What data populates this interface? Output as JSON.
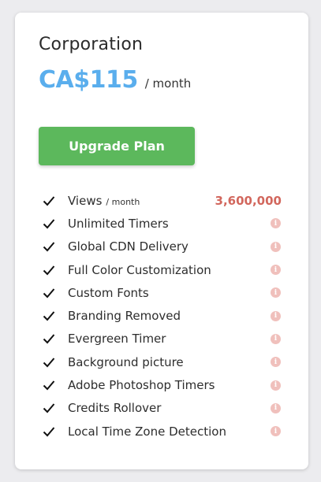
{
  "plan": {
    "name": "Corporation",
    "price": "CA$115",
    "period": "/ month",
    "upgrade_label": "Upgrade Plan"
  },
  "views": {
    "label": "Views",
    "unit": "/ month",
    "value": "3,600,000"
  },
  "features": [
    {
      "label": "Unlimited Timers"
    },
    {
      "label": "Global CDN Delivery"
    },
    {
      "label": "Full Color Customization"
    },
    {
      "label": "Custom Fonts"
    },
    {
      "label": "Branding Removed"
    },
    {
      "label": "Evergreen Timer"
    },
    {
      "label": "Background picture"
    },
    {
      "label": "Adobe Photoshop Timers"
    },
    {
      "label": "Credits Rollover"
    },
    {
      "label": "Local Time Zone Detection"
    }
  ],
  "icons": {
    "check": "check-icon",
    "info": "info-icon",
    "info_glyph": "i"
  },
  "colors": {
    "price": "#5aaeed",
    "button": "#5cb85c",
    "views_value": "#d2675d",
    "info_icon": "#f0c0bc"
  }
}
